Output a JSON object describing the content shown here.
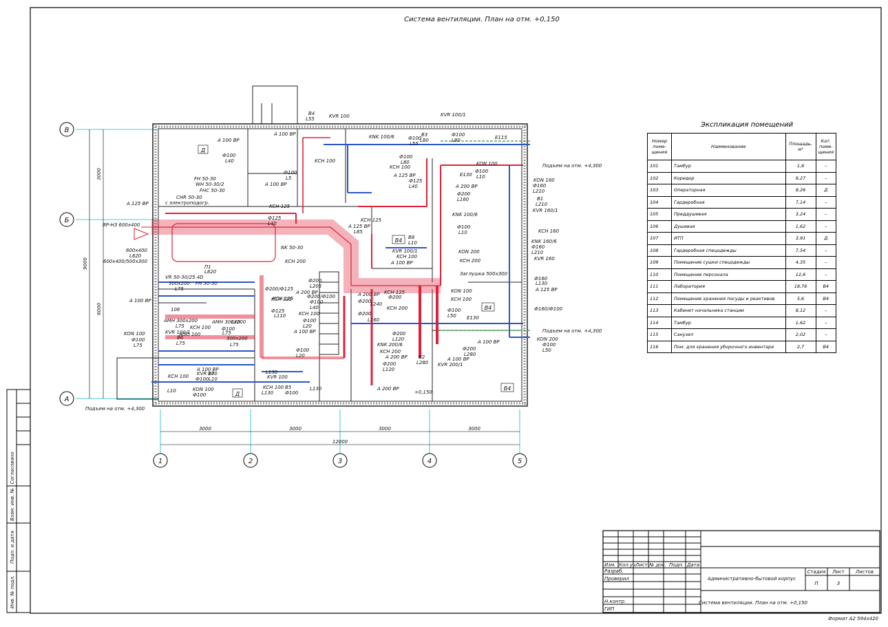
{
  "sheet_title": "Система вентиляции. План на отм. +0,150",
  "explication": {
    "title": "Экспликация помещений",
    "headers": {
      "number": "Номер поме-щения",
      "name": "Наименование",
      "area": "Площадь, м²",
      "category": "Кат. поме-щения"
    },
    "rooms": [
      {
        "number": "101",
        "name": "Тамбур",
        "area": "1,8",
        "cat": "–"
      },
      {
        "number": "102",
        "name": "Коридор",
        "area": "9,27",
        "cat": "–"
      },
      {
        "number": "103",
        "name": "Операторная",
        "area": "8,26",
        "cat": "Д"
      },
      {
        "number": "104",
        "name": "Гардеробная",
        "area": "7,14",
        "cat": "–"
      },
      {
        "number": "105",
        "name": "Преддушевая",
        "area": "3,24",
        "cat": "–"
      },
      {
        "number": "106",
        "name": "Душевая",
        "area": "1,62",
        "cat": "–"
      },
      {
        "number": "107",
        "name": "ИТП",
        "area": "3,91",
        "cat": "Д"
      },
      {
        "number": "108",
        "name": "Гардеробная спецодежды",
        "area": "7,54",
        "cat": "–"
      },
      {
        "number": "109",
        "name": "Помещение сушки спецодежды",
        "area": "4,35",
        "cat": "–"
      },
      {
        "number": "110",
        "name": "Помещение персонала",
        "area": "12,6",
        "cat": "–"
      },
      {
        "number": "111",
        "name": "Лаборатория",
        "area": "18,76",
        "cat": "В4"
      },
      {
        "number": "112",
        "name": "Помещение хранения посуды и реактивов",
        "area": "5,6",
        "cat": "В4"
      },
      {
        "number": "113",
        "name": "Кабинет начальника станции",
        "area": "8,12",
        "cat": "–"
      },
      {
        "number": "114",
        "name": "Тамбур",
        "area": "1,62",
        "cat": "–"
      },
      {
        "number": "115",
        "name": "Санузел",
        "area": "2,02",
        "cat": "–"
      },
      {
        "number": "116",
        "name": "Пом. для хранения уборочного инвентаря",
        "area": "2,7",
        "cat": "В4"
      }
    ]
  },
  "axes": {
    "letters": [
      "В",
      "Б",
      "А"
    ],
    "numbers": [
      "1",
      "2",
      "3",
      "4",
      "5"
    ],
    "dims_x": [
      "3000",
      "3000",
      "3000",
      "3000"
    ],
    "dim_total_x": "12000",
    "dims_y": [
      "3000",
      "6000"
    ],
    "dim_total_y": "9000"
  },
  "labels": {
    "rise1": "Подъем на отм. +4,300",
    "rise2": "Подъем на отм. +4,300",
    "rise3": "Подъем на отм. +4,300",
    "intake": "ВР-НЗ 600х400",
    "size1": "600х400",
    "size1l": "L820",
    "size2": "600х400/500х300",
    "plug": "Заглушка 500х300",
    "level": "+0,150",
    "ahu": [
      "CHR 50-30",
      "с электроподогр.",
      "FHC 50-30",
      "WH 50-30/2",
      "FH 50-30",
      "NK 50-30",
      "VR 50-30/25.4D",
      "FH 50-30",
      "П1",
      "L820"
    ],
    "room_d1": "Д",
    "room_d2": "Д",
    "room_b4a": "В4",
    "room_b4b": "В4",
    "room_b4c": "В4",
    "misc": [
      "A 100 BP",
      "Ф100",
      "L40",
      "B4",
      "L55",
      "KVR 100",
      "KNK 100/6",
      "KCH 100",
      "A 100 BP",
      "Ф100",
      "L5",
      "A 100 BP",
      "KVR 100/1",
      "Ф100",
      "L55",
      "B3",
      "L80",
      "Ф100",
      "L80",
      "E115",
      "Ф100",
      "L80",
      "KCH 100",
      "KON 100",
      "Ф100",
      "L10",
      "E130",
      "A 125 BP",
      "Ф125",
      "L40",
      "A 200 BP",
      "Ф200",
      "L160",
      "KON 160",
      "Ф160",
      "L210",
      "B1",
      "L210",
      "KVR 160/1",
      "KNK 100/6",
      "Ф100",
      "L10",
      "KCH 160",
      "KNK 160/6",
      "Ф160",
      "L210",
      "KVR 160",
      "A 125 BP",
      "KCH 125",
      "Ф125",
      "L40",
      "A 125 BP",
      "KCH 125",
      "L85",
      "B8",
      "L10",
      "KVR 100/1",
      "KCH 100",
      "A 100 BP",
      "KCH 200",
      "KON 200",
      "KCH 200",
      "Ф160",
      "L130",
      "A 125 BP",
      "Ф160/Ф100",
      "KON 100",
      "KCH 100",
      "Ф100",
      "L50",
      "E130",
      "KON 200",
      "Ф100",
      "L50",
      "A 100 BP",
      "Ф200",
      "L280",
      "KVR 200/1",
      "A 100 BP",
      "B2",
      "L280",
      "Ф200/Ф125",
      "Ф200",
      "L205",
      "A 200 BP",
      "KCH 125",
      "Ф200/Ф100",
      "Ф100",
      "L40",
      "KCH 100",
      "Ф100",
      "L20",
      "A 100 BP",
      "Ф100",
      "L20",
      "A 200 BP",
      "Ф200",
      "L240",
      "Ф200",
      "L160",
      "KCH 125",
      "Ф200",
      "KCH 200",
      "Ф200",
      "L120",
      "KNK 200/6",
      "KCH 200",
      "A 200 BP",
      "Ф200",
      "L120",
      "A 200 BP",
      "300х200",
      "L75",
      "A 100 BP",
      "Ф125",
      "L110",
      "KCH 125",
      "106",
      "AMH 300х200",
      "L75",
      "KON 100",
      "Ф100",
      "L75",
      "KVR 100/1",
      "B6",
      "L75",
      "AGO 100",
      "KCH 100",
      "Ф100",
      "L20",
      "AMH 300х200",
      "L75",
      "300х200",
      "L75",
      "A 100 BP",
      "KCH 100",
      "KVR 100",
      "B7",
      "Ф100",
      "L10",
      "L10",
      "KON 100",
      "Ф100",
      "L130",
      "KVR 100",
      "KCH 100",
      "B5",
      "Ф100",
      "L130",
      "L130",
      "A 100 BP"
    ]
  },
  "title_block": {
    "project": "Административно-бытовой корпус",
    "sheet_name": "Система вентиляции. План на отм. +0,150",
    "rows": [
      "Изм.",
      "Кол.уч",
      "Лист",
      "№ док.",
      "Подп.",
      "Дата"
    ],
    "roles": [
      "Разраб.",
      "Проверил",
      "Н.контр.",
      "ГИП"
    ],
    "stage_h": "Стадия",
    "sheet_h": "Лист",
    "sheets_h": "Листов",
    "stage": "П",
    "sheet": "3",
    "sheets": "",
    "format": "Формат А2 594х420"
  },
  "side_stamp": [
    "Согласовано",
    "Взам. инв. №",
    "Подп. и дата",
    "Инв. № подл."
  ]
}
